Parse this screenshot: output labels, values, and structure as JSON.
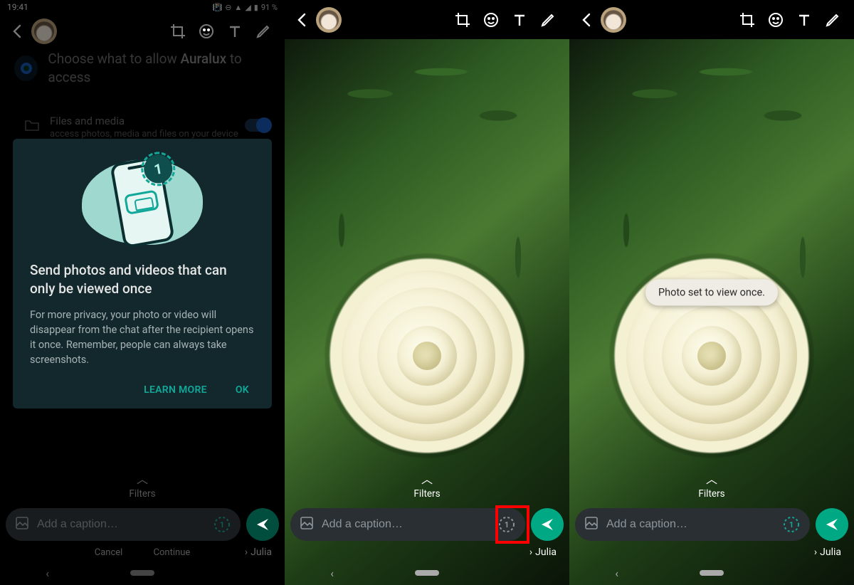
{
  "status": {
    "time": "19:41",
    "battery": "91 %"
  },
  "permission": {
    "title_prefix": "Choose what to allow ",
    "app_name": "Auralux",
    "title_suffix": " to access",
    "item_title": "Files and media",
    "item_desc": "access photos, media and files on your device"
  },
  "card": {
    "title": "Send photos and videos that can only be viewed once",
    "body": "For more privacy, your photo or video will disappear from the chat after the recipient opens it once. Remember, people can always take screenshots.",
    "learn": "LEARN MORE",
    "ok": "OK",
    "badge": "1"
  },
  "filters_label": "Filters",
  "caption_placeholder": "Add a caption…",
  "recipient": "Julia",
  "hidden": {
    "cancel": "Cancel",
    "continue": "Continue"
  },
  "toast": "Photo set to view once."
}
